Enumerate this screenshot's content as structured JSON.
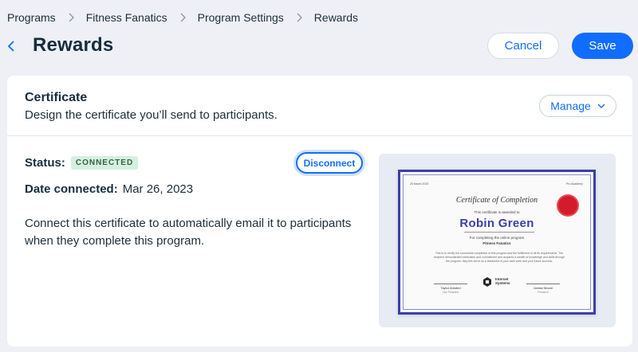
{
  "breadcrumb": {
    "items": [
      "Programs",
      "Fitness Fanatics",
      "Program Settings",
      "Rewards"
    ]
  },
  "header": {
    "title": "Rewards",
    "cancel_label": "Cancel",
    "save_label": "Save"
  },
  "card": {
    "title": "Certificate",
    "subtitle": "Design the certificate you’ll send to participants.",
    "manage_label": "Manage",
    "status_label": "Status:",
    "status_badge": "CONNECTED",
    "disconnect_label": "Disconnect",
    "date_label": "Date connected:",
    "date_value": "Mar 26, 2023",
    "description": "Connect this certificate to automatically email it to participants when they complete this program."
  },
  "certificate_preview": {
    "date_corner": "26 March 2023",
    "org_corner": "Pro Academy",
    "heading": "Certificate of Completion",
    "awarded_text": "This certificate is awarded to",
    "recipient": "Robin Green",
    "for_text": "For completing the online program",
    "program": "Fitness Fanatics",
    "body": "This is to certify the successful completion of this program and the fulfillment of all its requirements. The recipient demonstrated dedication and commitment and acquired a wealth of knowledge and skills through the program. May this serve as a testament of your hard work and your future success.",
    "signer_left_name": "Taylor Amsted",
    "signer_left_role": "Vice President",
    "signer_right_name": "Jordan Moore",
    "signer_right_role": "President",
    "logo_text_1": "Internet",
    "logo_text_2": "Systems"
  },
  "colors": {
    "accent": "#116dff",
    "badge_bg": "#d4f0de",
    "cert_border": "#3b3fa8",
    "seal": "#d41b2c",
    "page_bg": "#eef0f5"
  },
  "icons": {
    "back": "chevron-left-icon",
    "separator": "chevron-right-icon",
    "manage": "chevron-down-icon",
    "seal": "seal-icon",
    "logo": "internet-systems-logo-icon"
  }
}
